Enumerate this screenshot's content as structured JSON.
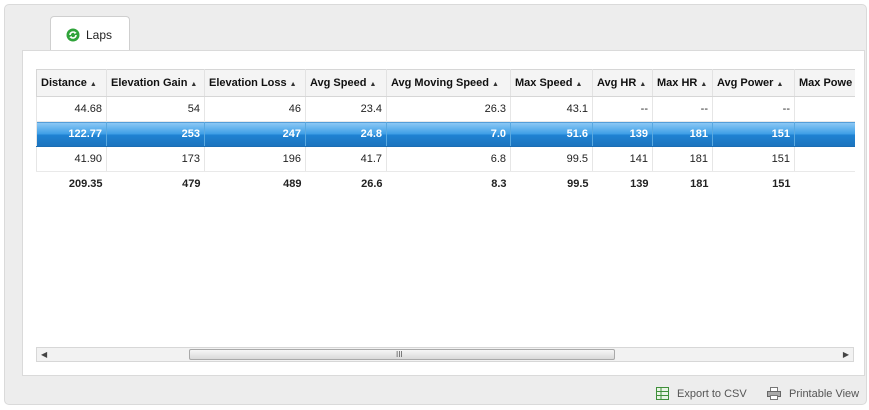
{
  "tab": {
    "label": "Laps"
  },
  "table": {
    "columns": [
      "Distance",
      "Elevation Gain",
      "Elevation Loss",
      "Avg Speed",
      "Avg Moving Speed",
      "Max Speed",
      "Avg HR",
      "Max HR",
      "Avg Power",
      "Max Powe"
    ],
    "rows": [
      [
        "44.68",
        "54",
        "46",
        "23.4",
        "26.3",
        "43.1",
        "--",
        "--",
        "--",
        ""
      ],
      [
        "122.77",
        "253",
        "247",
        "24.8",
        "7.0",
        "51.6",
        "139",
        "181",
        "151",
        ""
      ],
      [
        "41.90",
        "173",
        "196",
        "41.7",
        "6.8",
        "99.5",
        "141",
        "181",
        "151",
        ""
      ]
    ],
    "selected_row": 1,
    "totals": [
      "209.35",
      "479",
      "489",
      "26.6",
      "8.3",
      "99.5",
      "139",
      "181",
      "151",
      ""
    ]
  },
  "scrollbar": {
    "grip": "III"
  },
  "footer": {
    "export_label": "Export to CSV",
    "print_label": "Printable View"
  },
  "colors": {
    "selected_row": "#3d9ee6",
    "tab_icon": "#2fa33a"
  },
  "icons": {
    "tab": "refresh-icon",
    "export": "spreadsheet-icon",
    "print": "printer-icon"
  }
}
